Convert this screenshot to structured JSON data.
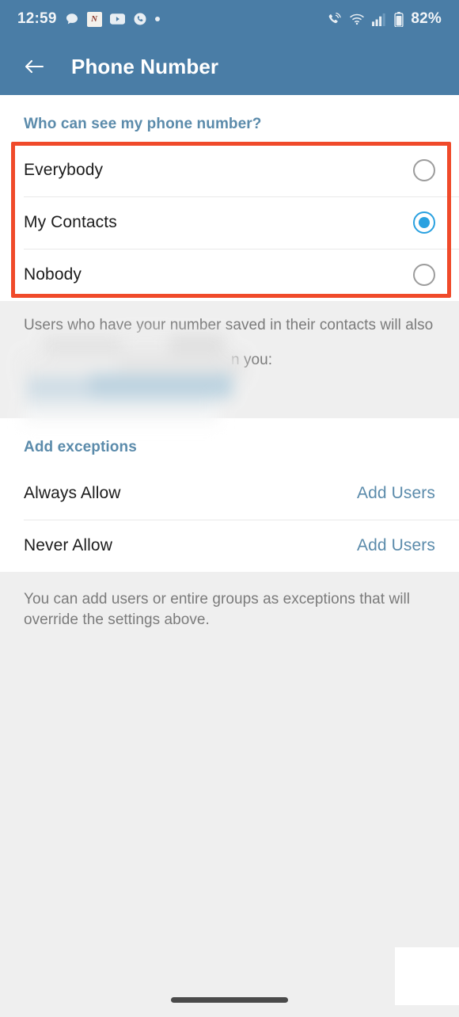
{
  "status_bar": {
    "time": "12:59",
    "battery_percent": "82%",
    "left_icons": [
      {
        "name": "chat-bubble-icon",
        "glyph": "chat"
      },
      {
        "name": "app-notification-icon",
        "glyph": "N"
      },
      {
        "name": "youtube-icon",
        "glyph": "youtube"
      },
      {
        "name": "phone-call-icon",
        "glyph": "phone"
      },
      {
        "name": "more-notifications-dot-icon",
        "glyph": "dot"
      }
    ],
    "right_icons": [
      {
        "name": "call-signal-icon",
        "glyph": "call-wave"
      },
      {
        "name": "wifi-icon",
        "glyph": "wifi"
      },
      {
        "name": "cellular-signal-icon",
        "glyph": "bars"
      },
      {
        "name": "battery-icon",
        "glyph": "battery"
      }
    ]
  },
  "app_bar": {
    "back_label": "Back",
    "title": "Phone Number"
  },
  "privacy_section": {
    "header": "Who can see my phone number?",
    "options": [
      {
        "label": "Everybody",
        "selected": false
      },
      {
        "label": "My Contacts",
        "selected": true
      },
      {
        "label": "Nobody",
        "selected": false
      }
    ],
    "footnote_visible_text": "Users who have your number saved in their contacts will also",
    "footnote_tail_text": "n you:"
  },
  "exceptions_section": {
    "header": "Add exceptions",
    "rows": [
      {
        "label": "Always Allow",
        "action": "Add Users"
      },
      {
        "label": "Never Allow",
        "action": "Add Users"
      }
    ],
    "footnote": "You can add users or entire groups as exceptions that will override the settings above."
  },
  "colors": {
    "app_bar": "#4a7da6",
    "accent_blue": "#5b8bab",
    "radio_selected": "#2aa1e0",
    "highlight_red": "#f04a2a",
    "page_background": "#efefef"
  }
}
